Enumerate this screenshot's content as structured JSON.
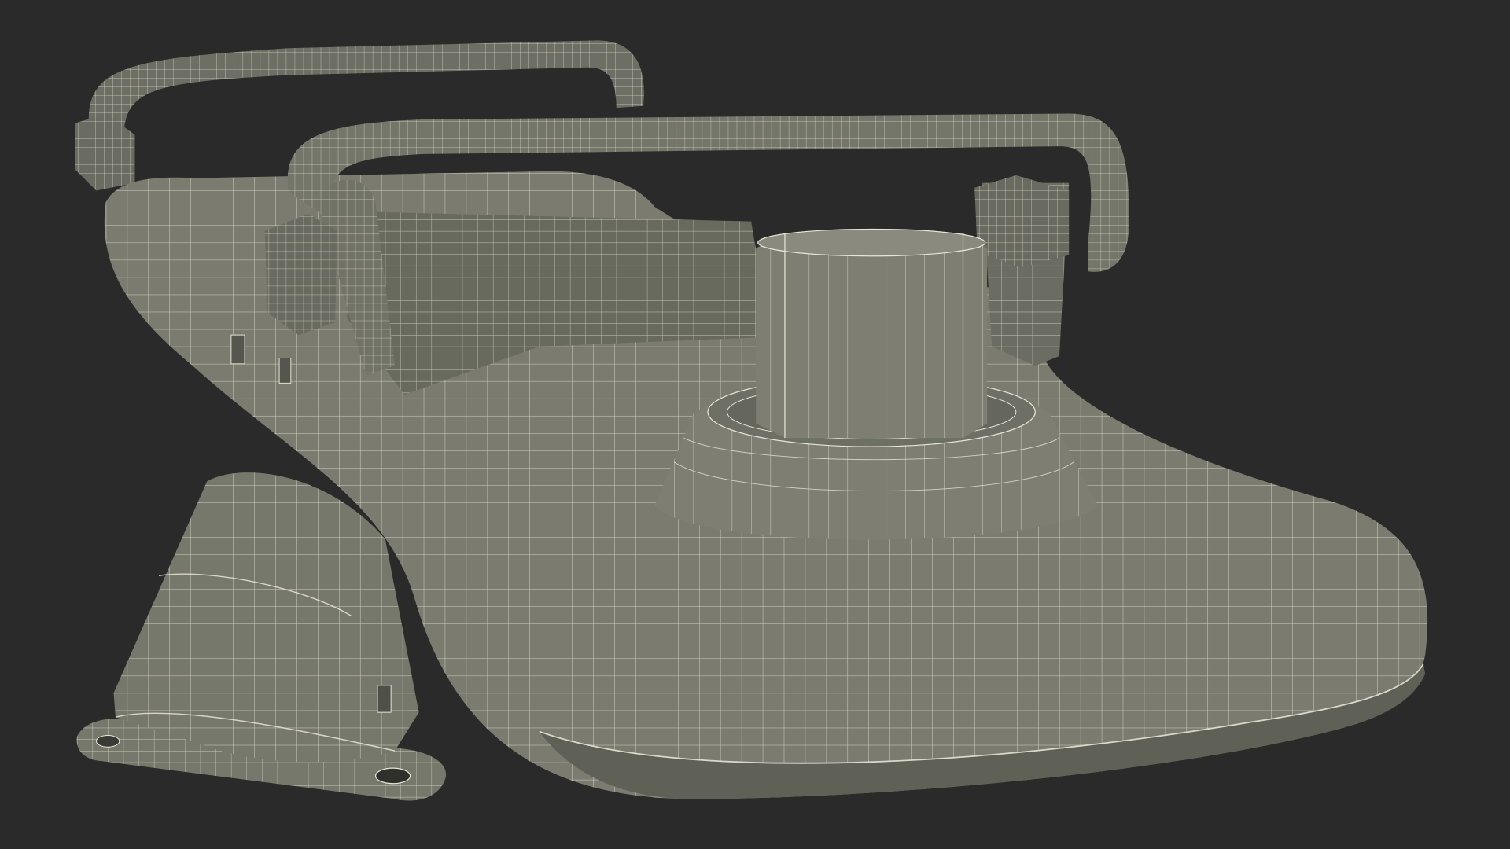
{
  "scene": {
    "background_color": "#2a2a2a",
    "surface_color": "#7b7c6f",
    "surface_shadow_color": "#5f6056",
    "surface_dark_color": "#4a4b43",
    "wire_color": "#e6e6d6"
  }
}
